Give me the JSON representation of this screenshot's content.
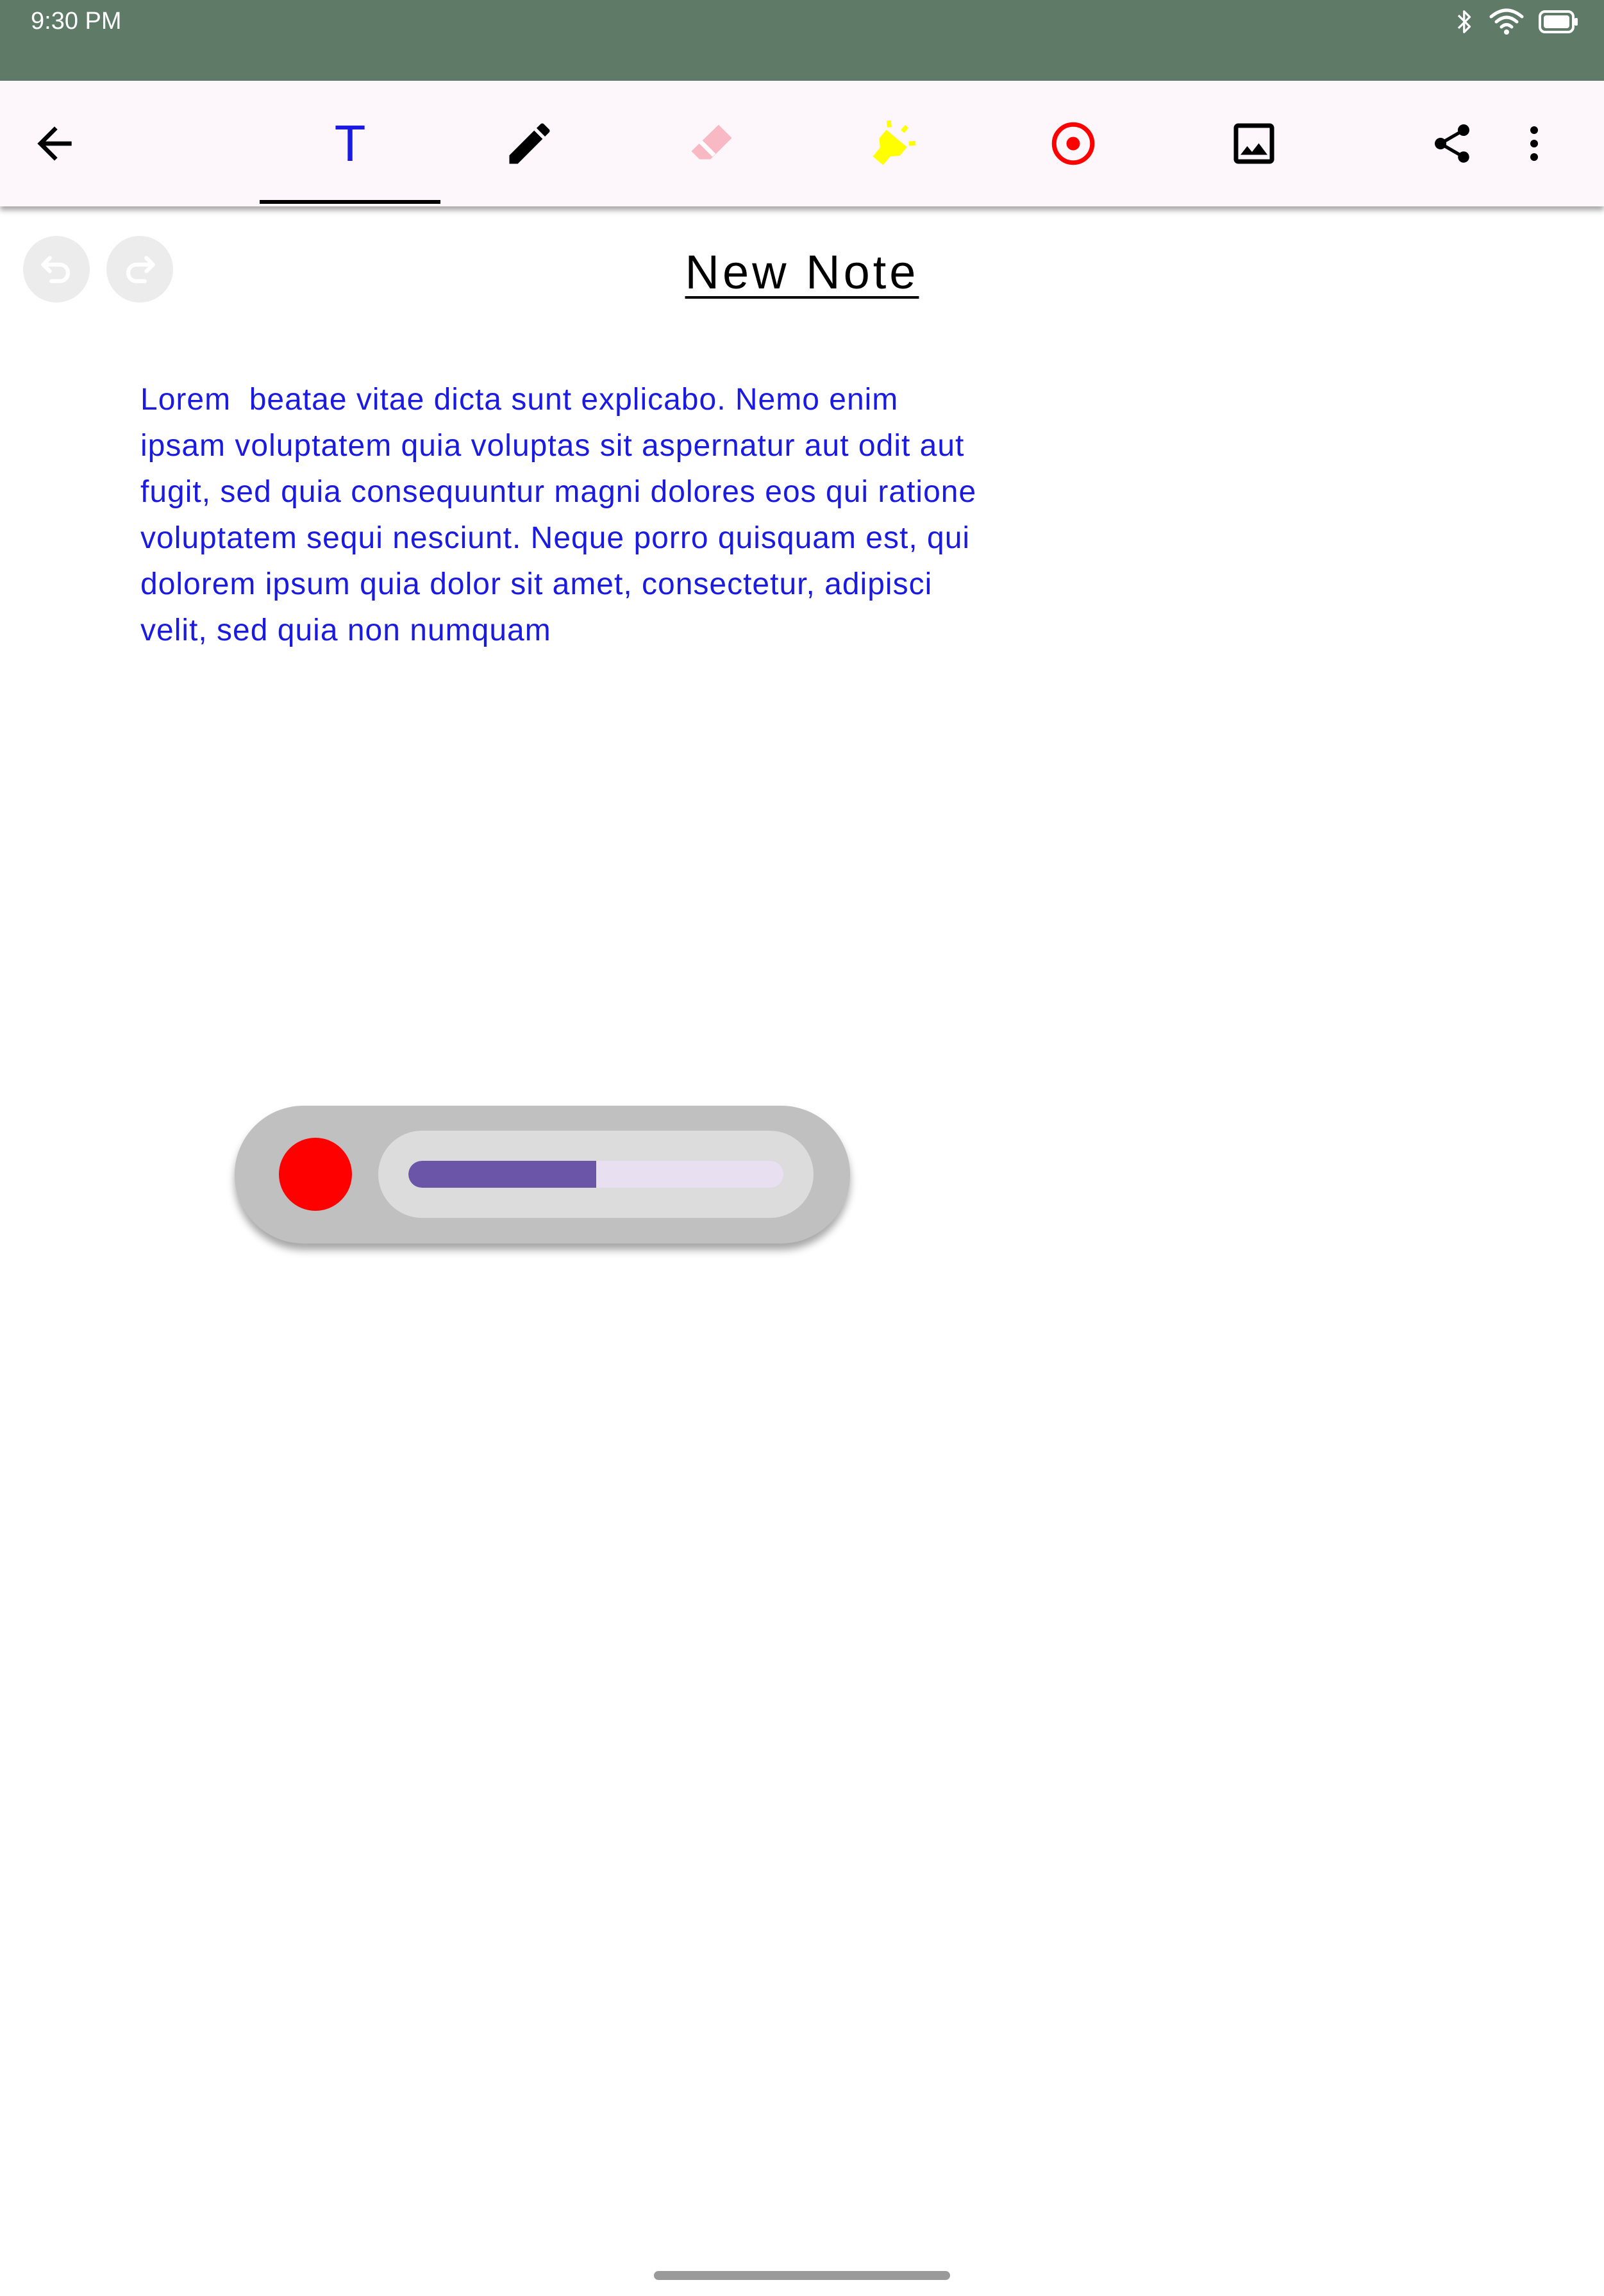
{
  "status_bar": {
    "time": "9:30 PM",
    "icons": [
      "bluetooth-icon",
      "wifi-icon",
      "battery-icon"
    ]
  },
  "toolbar": {
    "back_icon": "arrow-left-icon",
    "tools": [
      {
        "name": "text",
        "glyph": "T",
        "icon": "text-tool-icon",
        "color": "#1a1ae0",
        "selected": true
      },
      {
        "name": "pen",
        "icon": "pen-icon",
        "color": "#000000",
        "selected": false
      },
      {
        "name": "eraser",
        "icon": "eraser-icon",
        "color": "#f8b8c4",
        "selected": false
      },
      {
        "name": "highlighter",
        "icon": "highlighter-icon",
        "color": "#ffff00",
        "selected": false
      },
      {
        "name": "record",
        "icon": "record-icon",
        "color": "#ff0000",
        "selected": false
      },
      {
        "name": "image",
        "icon": "image-icon",
        "color": "#000000",
        "selected": false
      }
    ],
    "share_icon": "share-icon",
    "more_icon": "more-vert-icon"
  },
  "history": {
    "undo_icon": "undo-icon",
    "redo_icon": "redo-icon",
    "enabled": false
  },
  "note": {
    "title": "New Note",
    "body": "Lorem  beatae vitae dicta sunt explicabo. Nemo enim\nipsam voluptatem quia voluptas sit aspernatur aut odit aut\nfugit, sed quia consequuntur magni dolores eos qui ratione\nvoluptatem sequi nesciunt. Neque porro quisquam est, qui\ndolorem ipsum quia dolor sit amet, consectetur, adipisci\nvelit, sed quia non numquam",
    "text_color": "#1a1ae0"
  },
  "recorder": {
    "record_button_color": "#ff0000",
    "progress_fraction": 0.5,
    "progress_color": "#6a55a8"
  },
  "colors": {
    "status_bar": "#5f7b68",
    "toolbar_bg": "#fdf7fb"
  }
}
